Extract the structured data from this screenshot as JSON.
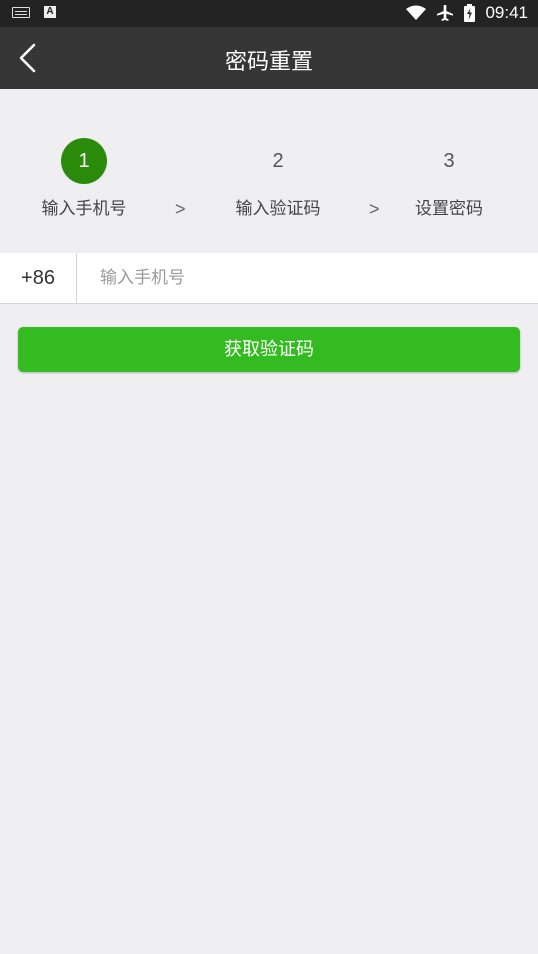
{
  "status_bar": {
    "time": "09:41",
    "left_badge": "A"
  },
  "header": {
    "title": "密码重置"
  },
  "steps": [
    {
      "number": "1",
      "label": "输入手机号",
      "active": true
    },
    {
      "number": "2",
      "label": "输入验证码",
      "active": false
    },
    {
      "number": "3",
      "label": "设置密码",
      "active": false
    }
  ],
  "step_separator": ">",
  "phone": {
    "country_code": "+86",
    "placeholder": "输入手机号",
    "value": ""
  },
  "actions": {
    "get_code_label": "获取验证码"
  },
  "colors": {
    "accent": "#34bb22",
    "active_step": "#2a8b0a",
    "titlebar": "#363636",
    "statusbar": "#232323",
    "background": "#efeff2"
  }
}
